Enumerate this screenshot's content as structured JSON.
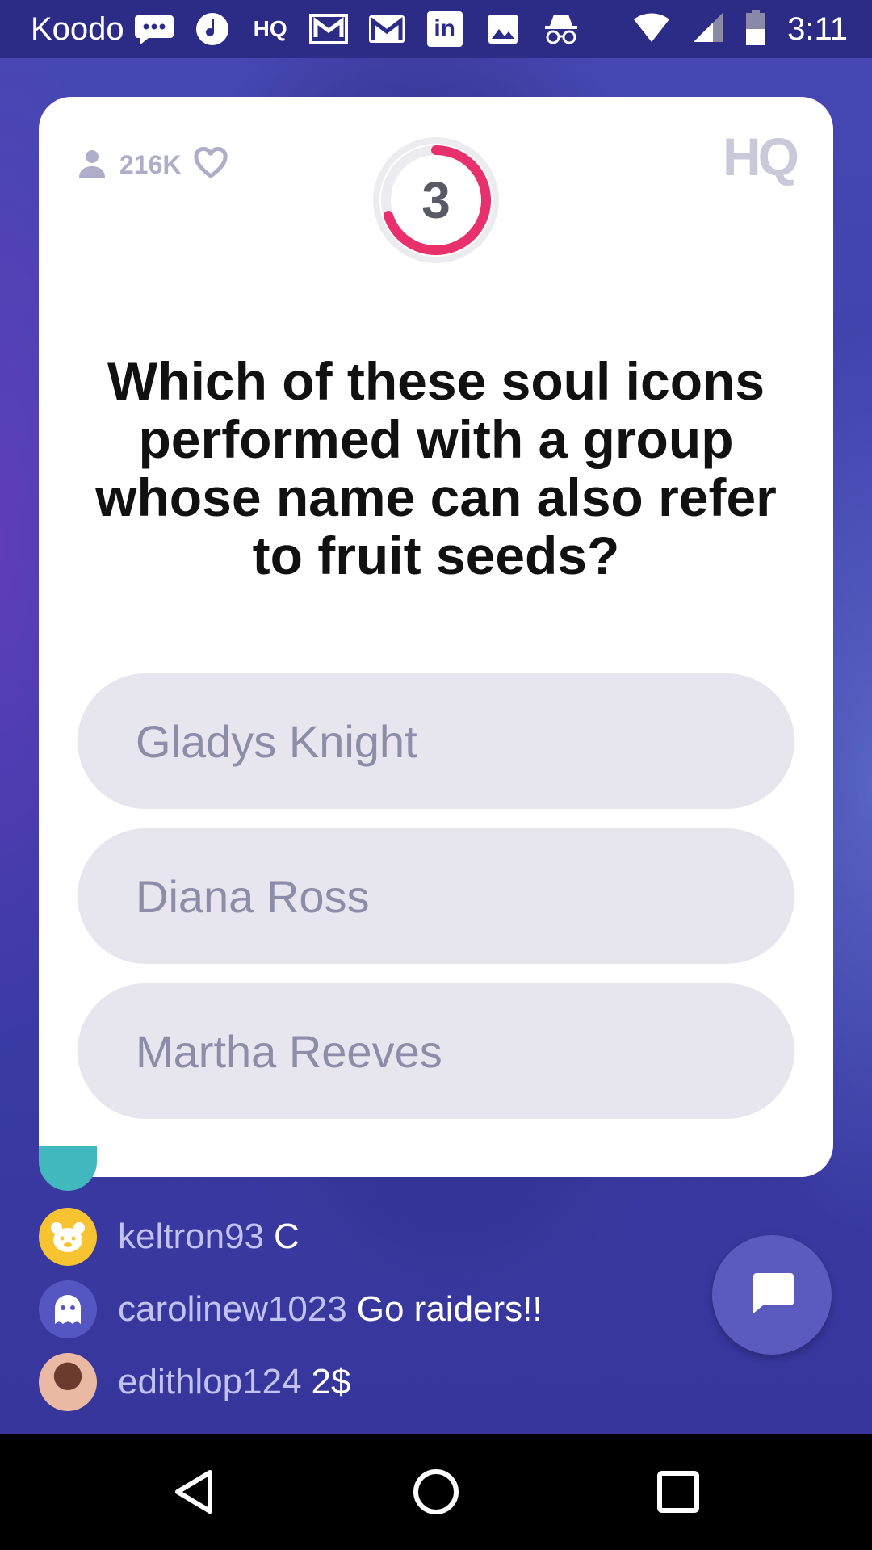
{
  "status_bar": {
    "carrier": "Koodo",
    "time": "3:11",
    "icons": [
      "messaging-icon",
      "music-icon",
      "hq-app-icon",
      "mailbox-icon",
      "gmail-icon",
      "linkedin-icon",
      "gallery-icon",
      "incognito-icon",
      "wifi-icon",
      "signal-icon",
      "battery-icon"
    ],
    "hq_icon_text": "HQ",
    "linkedin_text": "in"
  },
  "card": {
    "viewer_count": "216K",
    "countdown": "3",
    "countdown_progress": 0.7,
    "logo_text": "HQ",
    "question": "Which of these soul icons performed with a group whose name can also refer to fruit seeds?",
    "answers": [
      "Gladys Knight",
      "Diana Ross",
      "Martha Reeves"
    ]
  },
  "chat": {
    "messages": [
      {
        "user": "keltron93",
        "message": "C"
      },
      {
        "user": "carolinew1023",
        "message": "Go raiders!!"
      },
      {
        "user": "edithlop124",
        "message": "2$"
      }
    ]
  },
  "colors": {
    "background": "#3a3aa6",
    "timer_accent": "#e8306c",
    "answer_bg": "#e7e6ef",
    "answer_text": "#8d8ca9",
    "chat_username": "#c2c2f2",
    "chat_button": "#5b5bbf"
  }
}
